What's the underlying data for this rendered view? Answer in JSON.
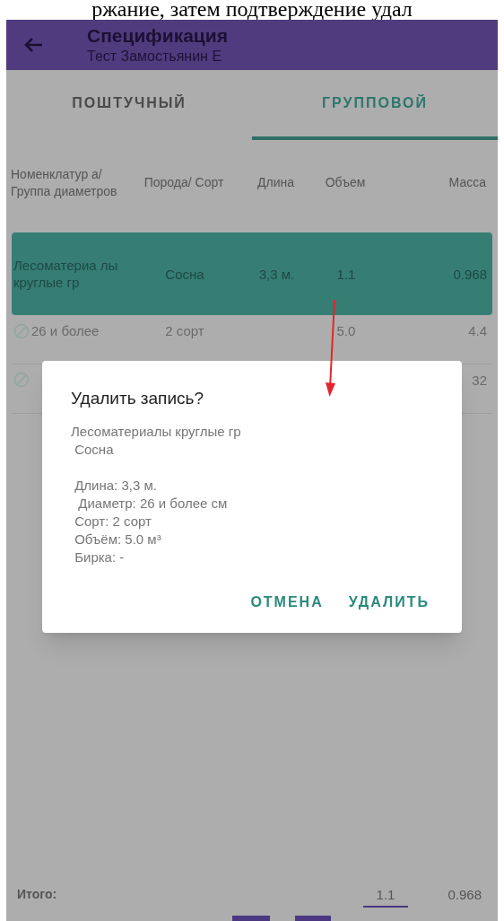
{
  "caption": "ржание, затем подтверждение удал",
  "app_bar": {
    "title": "Спецификация",
    "subtitle": "Тест Замостьянин Е"
  },
  "tabs": [
    {
      "label": "ПОШТУЧНЫЙ",
      "selected": false
    },
    {
      "label": "ГРУППОВОЙ",
      "selected": true
    }
  ],
  "table": {
    "columns": [
      "Номенклатур а/ Группа диаметров",
      "Порода/ Сорт",
      "Длина",
      "Объем",
      "Масса"
    ],
    "rows": [
      {
        "kind": "group",
        "selected": true,
        "cells": [
          "Лесоматериа лы круглые гр",
          "Сосна",
          "3,3 м.",
          "1.1",
          "0.968"
        ]
      },
      {
        "kind": "item",
        "selected": false,
        "cells": [
          "26 и более",
          "2 сорт",
          "",
          "5.0",
          "4.4"
        ]
      },
      {
        "kind": "item",
        "selected": false,
        "cells": [
          "",
          "",
          "",
          "",
          "32"
        ]
      }
    ]
  },
  "totals": {
    "label": "Итого:",
    "volume": "1.1",
    "mass": "0.968"
  },
  "dialog": {
    "title": "Удалить запись?",
    "paragraphs": [
      [
        "Лесоматериалы круглые гр",
        " Сосна"
      ],
      [
        " Длина: 3,3 м.",
        "  Диаметр: 26 и более см",
        " Сорт: 2 сорт",
        " Объём: 5.0 м³",
        " Бирка: -"
      ]
    ],
    "buttons": [
      "ОТМЕНА",
      "УДАЛИТЬ"
    ]
  }
}
